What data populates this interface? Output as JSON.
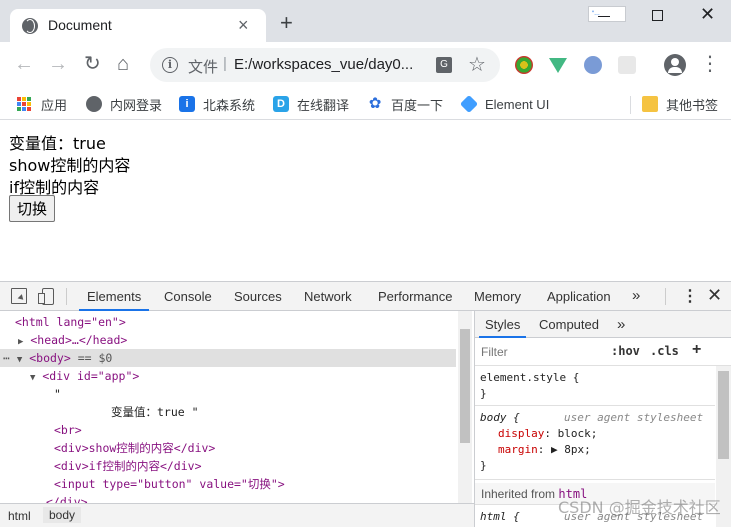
{
  "browser": {
    "tab_title": "Document",
    "new_tab": "+",
    "tab_close": "×",
    "scheme_label": "文件",
    "url": "E:/workspaces_vue/day0...",
    "avatar_chip_text": "“…",
    "window_close": "✕"
  },
  "bookmarks": [
    {
      "label": "应用",
      "icon": "apps-icon"
    },
    {
      "label": "内网登录",
      "icon": "globe-icon",
      "color": "#5f6368"
    },
    {
      "label": "北森系统",
      "icon": "info-icon",
      "color": "#1a73e8"
    },
    {
      "label": "在线翻译",
      "icon": "translate-icon",
      "color": "#2aa3e8"
    },
    {
      "label": "百度一下",
      "icon": "paw-icon",
      "color": "#2d6fdc"
    },
    {
      "label": "Element UI",
      "icon": "element-icon",
      "color": "#409eff"
    },
    {
      "label": "其他书签",
      "icon": "folder-icon",
      "color": "#f5c342"
    }
  ],
  "page": {
    "var_line": "变量值：true",
    "show_line": "show控制的内容",
    "if_line": "if控制的内容",
    "toggle_button": "切换"
  },
  "devtools": {
    "tabs": [
      "Elements",
      "Console",
      "Sources",
      "Network",
      "Performance",
      "Memory",
      "Application"
    ],
    "more": "»",
    "elements": {
      "html_open": "<html lang=\"en\">",
      "head": "<head>…</head>",
      "body_tag": "<body>",
      "body_eq": "== $0",
      "div_app": "<div id=\"app\">",
      "quote": "\"",
      "text_node": "变量值：true \"",
      "br": "<br>",
      "div_show": "<div>show控制的内容</div>",
      "div_if": "<div>if控制的内容</div>",
      "input_line": "<input type=\"button\" value=\"切换\">",
      "div_close": "</div>"
    },
    "breadcrumbs": [
      "html",
      "body"
    ],
    "styles": {
      "tabs": [
        "Styles",
        "Computed"
      ],
      "more": "»",
      "filter_placeholder": "Filter",
      "hov": ":hov",
      "cls": ".cls",
      "plus": "+",
      "element_style_open": "element.style {",
      "close_brace": "}",
      "body_selector": "body {",
      "ua_label": "user agent stylesheet",
      "display_prop": "display",
      "display_val": "block;",
      "margin_prop": "margin",
      "margin_val": "▶ 8px;",
      "inherited_label": "Inherited from",
      "inherited_tag": "html",
      "html_selector": "html {",
      "ua_label2": "user agent stylesheet"
    }
  },
  "watermark": "CSDN @掘金技术社区"
}
